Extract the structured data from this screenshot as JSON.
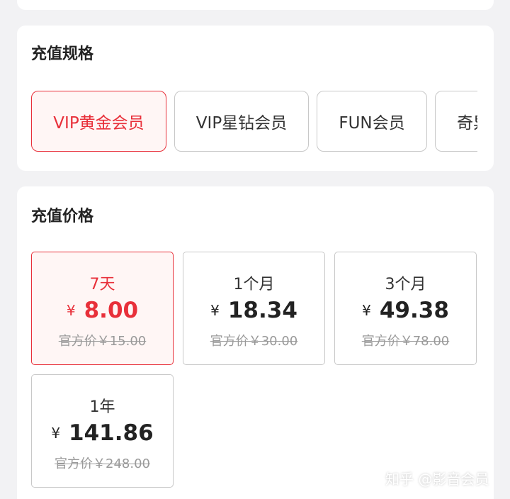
{
  "spec_section": {
    "title": "充值规格",
    "options": [
      {
        "label": "VIP黄金会员",
        "selected": true
      },
      {
        "label": "VIP星钻会员",
        "selected": false
      },
      {
        "label": "FUN会员",
        "selected": false
      },
      {
        "label": "奇异果",
        "selected": false
      }
    ]
  },
  "price_section": {
    "title": "充值价格",
    "options": [
      {
        "label": "7天",
        "currency": "¥",
        "price": "8.00",
        "original": "官方价￥15.00",
        "selected": true
      },
      {
        "label": "1个月",
        "currency": "¥",
        "price": "18.34",
        "original": "官方价￥30.00",
        "selected": false
      },
      {
        "label": "3个月",
        "currency": "¥",
        "price": "49.38",
        "original": "官方价￥78.00",
        "selected": false
      },
      {
        "label": "1年",
        "currency": "¥",
        "price": "141.86",
        "original": "官方价￥248.00",
        "selected": false
      }
    ]
  },
  "watermark": "知乎 @影音会员",
  "colors": {
    "accent": "#e8303a",
    "selected_bg": "#fff6f5",
    "page_bg": "#f2f2f4"
  }
}
